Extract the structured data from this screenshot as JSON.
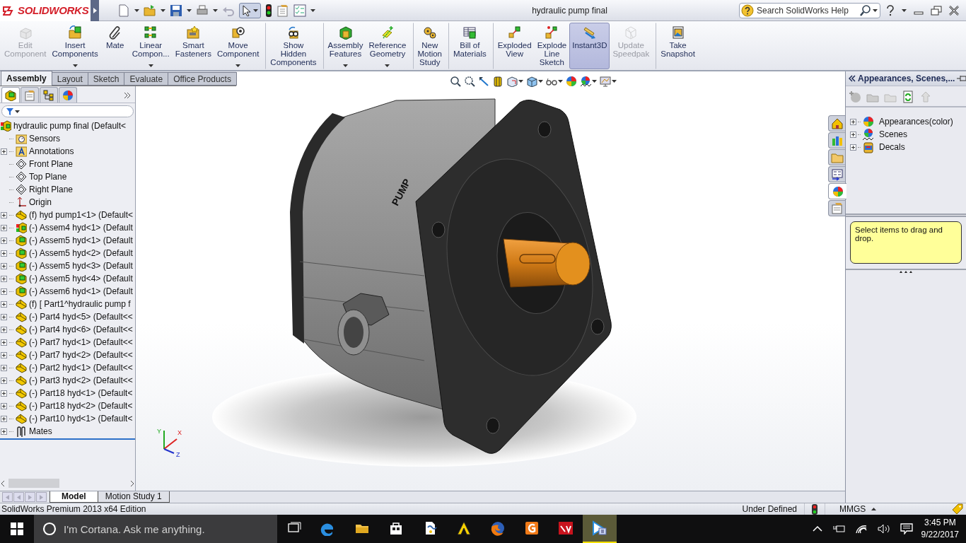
{
  "app": {
    "logo": "SOLIDWORKS"
  },
  "window": {
    "title": "hydraulic pump final"
  },
  "search": {
    "placeholder": "Search SolidWorks Help"
  },
  "command_manager": [
    {
      "kind": "edit",
      "label": "Edit\nComponent",
      "disabled": true,
      "selected": false,
      "dropdown": false,
      "group_start": false
    },
    {
      "kind": "insert",
      "label": "Insert\nComponents",
      "disabled": false,
      "selected": false,
      "dropdown": true,
      "group_start": false
    },
    {
      "kind": "mate",
      "label": "Mate",
      "disabled": false,
      "selected": false,
      "dropdown": false,
      "group_start": false
    },
    {
      "kind": "pattern",
      "label": "Linear\nCompon...",
      "disabled": false,
      "selected": false,
      "dropdown": true,
      "group_start": false
    },
    {
      "kind": "fasteners",
      "label": "Smart\nFasteners",
      "disabled": false,
      "selected": false,
      "dropdown": false,
      "group_start": false
    },
    {
      "kind": "move",
      "label": "Move\nComponent",
      "disabled": false,
      "selected": false,
      "dropdown": true,
      "group_start": false
    },
    {
      "kind": "hidden",
      "label": "Show\nHidden\nComponents",
      "disabled": false,
      "selected": false,
      "dropdown": false,
      "group_start": true
    },
    {
      "kind": "features",
      "label": "Assembly\nFeatures",
      "disabled": false,
      "selected": false,
      "dropdown": true,
      "group_start": true
    },
    {
      "kind": "reference",
      "label": "Reference\nGeometry",
      "disabled": false,
      "selected": false,
      "dropdown": true,
      "group_start": false
    },
    {
      "kind": "motion",
      "label": "New\nMotion\nStudy",
      "disabled": false,
      "selected": false,
      "dropdown": false,
      "group_start": true
    },
    {
      "kind": "bom",
      "label": "Bill of\nMaterials",
      "disabled": false,
      "selected": false,
      "dropdown": false,
      "group_start": true
    },
    {
      "kind": "exploded",
      "label": "Exploded\nView",
      "disabled": false,
      "selected": false,
      "dropdown": false,
      "group_start": true
    },
    {
      "kind": "explodeline",
      "label": "Explode\nLine\nSketch",
      "disabled": false,
      "selected": false,
      "dropdown": false,
      "group_start": false
    },
    {
      "kind": "instant3d",
      "label": "Instant3D",
      "disabled": false,
      "selected": true,
      "dropdown": false,
      "group_start": false
    },
    {
      "kind": "speedpak",
      "label": "Update\nSpeedpak",
      "disabled": true,
      "selected": false,
      "dropdown": false,
      "group_start": false
    },
    {
      "kind": "snapshot",
      "label": "Take\nSnapshot",
      "disabled": false,
      "selected": false,
      "dropdown": false,
      "group_start": true
    }
  ],
  "tabs": [
    {
      "label": "Assembly",
      "selected": true
    },
    {
      "label": "Layout",
      "selected": false
    },
    {
      "label": "Sketch",
      "selected": false
    },
    {
      "label": "Evaluate",
      "selected": false
    },
    {
      "label": "Office Products",
      "selected": false
    }
  ],
  "feature_tree": {
    "root": {
      "kind": "assembly",
      "label": "hydraulic pump final  (Default<",
      "children": [
        {
          "kind": "sensors",
          "label": "Sensors",
          "expandable": false
        },
        {
          "kind": "annotations",
          "label": "Annotations",
          "expandable": true
        },
        {
          "kind": "plane",
          "label": "Front Plane",
          "expandable": false
        },
        {
          "kind": "plane",
          "label": "Top Plane",
          "expandable": false
        },
        {
          "kind": "plane",
          "label": "Right Plane",
          "expandable": false
        },
        {
          "kind": "origin",
          "label": "Origin",
          "expandable": false
        },
        {
          "kind": "part",
          "label": "(f) hyd pump1<1>  (Default<",
          "expandable": true
        },
        {
          "kind": "assembly",
          "label": "(-) Assem4 hyd<1>  (Default",
          "expandable": true
        },
        {
          "kind": "subassembly",
          "label": "(-) Assem5 hyd<1>  (Default",
          "expandable": true
        },
        {
          "kind": "subassembly",
          "label": "(-) Assem5 hyd<2>  (Default",
          "expandable": true
        },
        {
          "kind": "subassembly",
          "label": "(-) Assem5 hyd<3>  (Default",
          "expandable": true
        },
        {
          "kind": "subassembly",
          "label": "(-) Assem5 hyd<4>  (Default",
          "expandable": true
        },
        {
          "kind": "subassembly",
          "label": "(-) Assem6 hyd<1>  (Default",
          "expandable": true
        },
        {
          "kind": "part",
          "label": "(f) [ Part1^hydraulic pump f",
          "expandable": true
        },
        {
          "kind": "part",
          "label": "(-) Part4 hyd<5>  (Default<<",
          "expandable": true
        },
        {
          "kind": "part",
          "label": "(-) Part4 hyd<6>  (Default<<",
          "expandable": true
        },
        {
          "kind": "part",
          "label": "(-) Part7 hyd<1>  (Default<<",
          "expandable": true
        },
        {
          "kind": "part",
          "label": "(-) Part7 hyd<2>  (Default<<",
          "expandable": true
        },
        {
          "kind": "part",
          "label": "(-) Part2 hyd<1>  (Default<<",
          "expandable": true
        },
        {
          "kind": "part",
          "label": "(-) Part3 hyd<2>  (Default<<",
          "expandable": true
        },
        {
          "kind": "part",
          "label": "(-) Part18 hyd<1>  (Default<",
          "expandable": true
        },
        {
          "kind": "part",
          "label": "(-) Part18 hyd<2>  (Default<",
          "expandable": true
        },
        {
          "kind": "part",
          "label": "(-) Part10 hyd<1>  (Default<",
          "expandable": true
        },
        {
          "kind": "mates",
          "label": "Mates",
          "expandable": true
        }
      ]
    }
  },
  "viewport": {
    "model_label": "PUMP",
    "triad": [
      "Y",
      "X",
      "Z"
    ]
  },
  "task_pane": {
    "title": "Appearances, Scenes,...",
    "tabs": [
      {
        "kind": "home",
        "selected": false
      },
      {
        "kind": "library",
        "selected": false
      },
      {
        "kind": "explorer",
        "selected": false
      },
      {
        "kind": "palette",
        "selected": false
      },
      {
        "kind": "appearances",
        "selected": true
      },
      {
        "kind": "properties",
        "selected": false
      }
    ],
    "items": [
      {
        "kind": "appearances",
        "label": "Appearances(color)"
      },
      {
        "kind": "scenes",
        "label": "Scenes"
      },
      {
        "kind": "decals",
        "label": "Decals"
      }
    ],
    "hint": "Select items to drag and drop."
  },
  "bottom_tabs": [
    {
      "label": "Model",
      "selected": true
    },
    {
      "label": "Motion Study 1",
      "selected": false
    }
  ],
  "status_bar": {
    "edition": "SolidWorks Premium 2013 x64 Edition",
    "state": "Under Defined",
    "units": "MMGS"
  },
  "taskbar": {
    "search_placeholder": "I'm Cortana. Ask me anything.",
    "apps": [
      {
        "kind": "taskview",
        "active": false
      },
      {
        "kind": "edge",
        "active": false
      },
      {
        "kind": "explorer",
        "active": false
      },
      {
        "kind": "store",
        "active": false
      },
      {
        "kind": "file",
        "active": false
      },
      {
        "kind": "chevron",
        "active": false
      },
      {
        "kind": "globe",
        "active": false
      },
      {
        "kind": "square",
        "active": false
      },
      {
        "kind": "cad",
        "active": false
      },
      {
        "kind": "player",
        "active": true
      }
    ],
    "time": "3:45 PM",
    "date": "9/22/2017"
  }
}
